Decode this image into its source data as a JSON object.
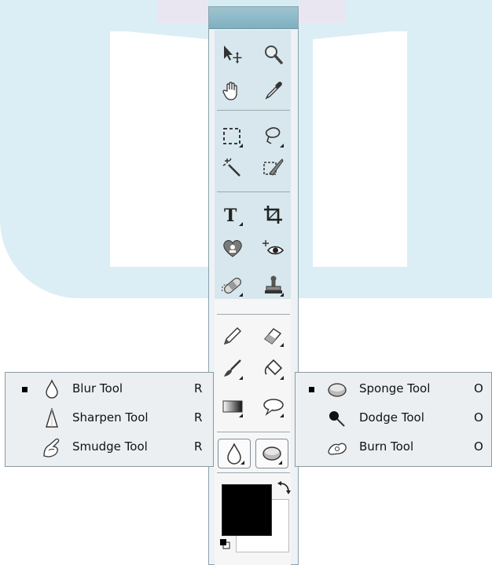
{
  "colors": {
    "watermark": "#dceef5",
    "toolbox_bg": "#eef2f4",
    "header": "#8fbacb",
    "foreground": "#000000",
    "background": "#ffffff"
  },
  "toolbox": {
    "tools": [
      {
        "name": "move-tool",
        "icon": "move-arrow-icon"
      },
      {
        "name": "zoom-tool",
        "icon": "magnifier-icon"
      },
      {
        "name": "hand-tool",
        "icon": "hand-icon"
      },
      {
        "name": "eyedropper-tool",
        "icon": "eyedropper-icon"
      },
      {
        "name": "marquee-tool",
        "icon": "dashed-rectangle-icon"
      },
      {
        "name": "lasso-tool",
        "icon": "lasso-icon"
      },
      {
        "name": "magic-wand-tool",
        "icon": "magic-wand-icon"
      },
      {
        "name": "quick-selection-tool",
        "icon": "quick-selection-icon"
      },
      {
        "name": "type-tool",
        "icon": "type-t-icon"
      },
      {
        "name": "crop-tool",
        "icon": "crop-icon"
      },
      {
        "name": "healing-tool",
        "icon": "heart-healing-icon"
      },
      {
        "name": "red-eye-tool",
        "icon": "red-eye-icon"
      },
      {
        "name": "spot-healing-tool",
        "icon": "bandage-icon"
      },
      {
        "name": "clone-stamp-tool",
        "icon": "stamp-icon"
      },
      {
        "name": "pencil-tool",
        "icon": "pencil-icon"
      },
      {
        "name": "eraser-tool",
        "icon": "eraser-icon"
      },
      {
        "name": "brush-tool",
        "icon": "brush-icon"
      },
      {
        "name": "paint-bucket-tool",
        "icon": "bucket-icon"
      },
      {
        "name": "gradient-tool",
        "icon": "gradient-icon"
      },
      {
        "name": "shape-tool",
        "icon": "speech-bubble-icon"
      },
      {
        "name": "blur-tool",
        "icon": "droplet-icon"
      },
      {
        "name": "sponge-tool",
        "icon": "sponge-icon"
      }
    ]
  },
  "blur_flyout": {
    "items": [
      {
        "label": "Blur Tool",
        "key": "R",
        "selected": true,
        "icon": "droplet-icon"
      },
      {
        "label": "Sharpen Tool",
        "key": "R",
        "selected": false,
        "icon": "sharpen-cone-icon"
      },
      {
        "label": "Smudge Tool",
        "key": "R",
        "selected": false,
        "icon": "finger-icon"
      }
    ]
  },
  "toning_flyout": {
    "items": [
      {
        "label": "Sponge Tool",
        "key": "O",
        "selected": true,
        "icon": "sponge-icon"
      },
      {
        "label": "Dodge Tool",
        "key": "O",
        "selected": false,
        "icon": "dodge-icon"
      },
      {
        "label": "Burn Tool",
        "key": "O",
        "selected": false,
        "icon": "burn-hand-icon"
      }
    ]
  }
}
